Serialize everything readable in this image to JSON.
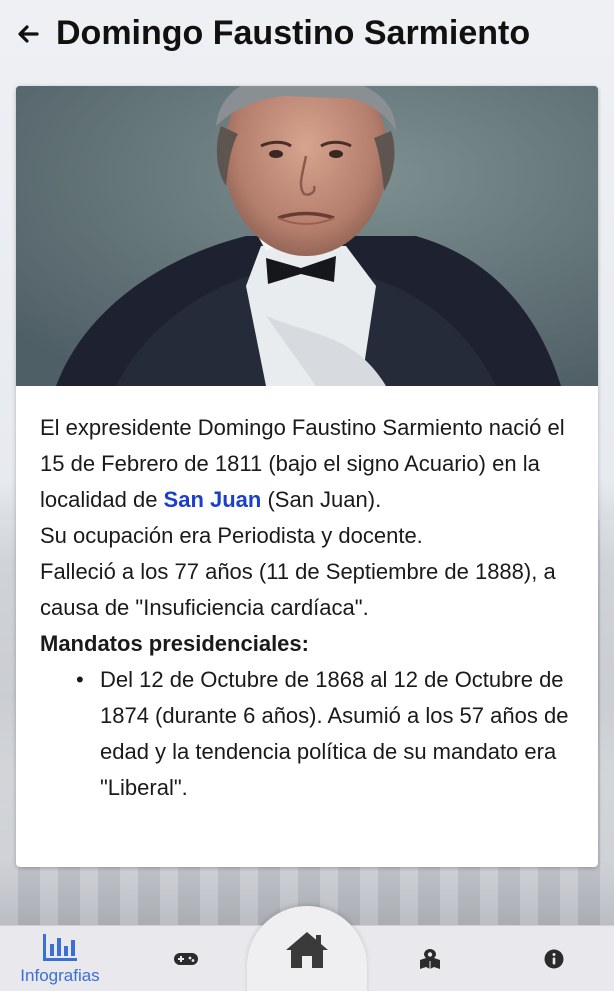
{
  "header": {
    "back_icon": "arrow-left-icon",
    "title": "Domingo Faustino Sarmiento"
  },
  "portrait": {
    "alt": "Domingo Faustino Sarmiento"
  },
  "bio": {
    "line1": "El expresidente Domingo Faustino Sarmiento nació el 15 de Febrero de 1811 (bajo el signo Acuario) en la localidad de ",
    "place_link": "San Juan",
    "line1_end": " (San Juan).",
    "occupation": "Su ocupación era Periodista y docente.",
    "death": "Falleció a los 77 años (11 de Septiembre de 1888), a causa de \"Insuficiencia cardíaca\".",
    "mandates_heading": "Mandatos presidenciales:",
    "mandates": [
      "Del 12 de Octubre de 1868 al 12 de Octubre de 1874 (durante 6 años). Asumió a los 57 años de edad y la tendencia política de su mandato era \"Liberal\"."
    ]
  },
  "nav": {
    "items": [
      {
        "icon": "bar-chart-icon",
        "label": "Infografias",
        "active": true
      },
      {
        "icon": "gamepad-icon",
        "label": ""
      },
      {
        "icon": "home-icon",
        "label": ""
      },
      {
        "icon": "map-icon",
        "label": ""
      },
      {
        "icon": "info-icon",
        "label": ""
      }
    ]
  },
  "colors": {
    "accent": "#3a6fd6",
    "link": "#1a3fcc",
    "text": "#111111"
  }
}
